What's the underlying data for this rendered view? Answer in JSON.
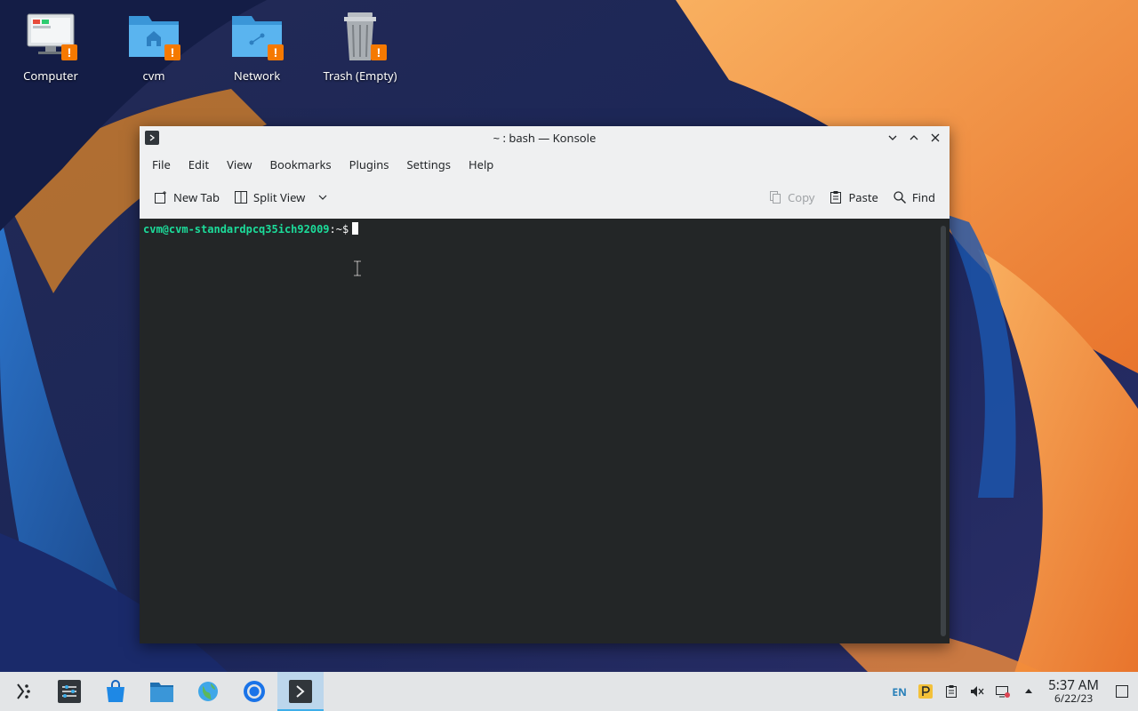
{
  "desktop": {
    "icons": [
      {
        "label": "Computer",
        "icon": "computer-icon"
      },
      {
        "label": "cvm",
        "icon": "home-folder-icon"
      },
      {
        "label": "Network",
        "icon": "network-folder-icon"
      },
      {
        "label": "Trash (Empty)",
        "icon": "trash-icon"
      }
    ],
    "warning_badge": "!"
  },
  "window": {
    "title": "~ : bash — Konsole",
    "menu": [
      "File",
      "Edit",
      "View",
      "Bookmarks",
      "Plugins",
      "Settings",
      "Help"
    ],
    "toolbar": {
      "new_tab": "New Tab",
      "split_view": "Split View",
      "copy": "Copy",
      "paste": "Paste",
      "find": "Find"
    },
    "terminal": {
      "prompt_user": "cvm@cvm-standardpcq35ich92009",
      "prompt_path": ":~$"
    }
  },
  "taskbar": {
    "tray": {
      "keyboard_layout": "EN",
      "time": "5:37 AM",
      "date": "6/22/23"
    }
  },
  "colors": {
    "accent": "#3daee9",
    "warning": "#f57900",
    "terminal_bg": "#232627",
    "prompt": "#1cdc9a"
  }
}
